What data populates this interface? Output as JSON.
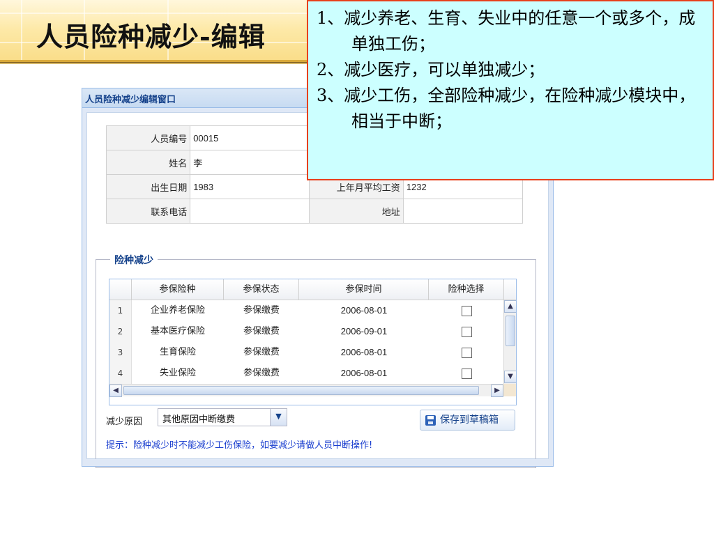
{
  "slide": {
    "title": "人员险种减少-编辑"
  },
  "callout": {
    "items": [
      "1、减少养老、生育、失业中的任意一个或多个，成单独工伤；",
      "2、减少医疗，可以单独减少；",
      "3、减少工伤，全部险种减少，在险种减少模块中，相当于中断；"
    ]
  },
  "window": {
    "title": "人员险种减少编辑窗口",
    "info": {
      "person_no_label": "人员编号",
      "person_no_value": "00015",
      "name_label": "姓名",
      "name_value": "李",
      "birth_label": "出生日期",
      "birth_value": "1983",
      "salary_label": "上年月平均工资",
      "salary_value": "1232",
      "phone_label": "联系电话",
      "phone_value": "",
      "address_label": "地址",
      "address_value": ""
    },
    "fieldset_title": "险种减少",
    "grid": {
      "columns": [
        "参保险种",
        "参保状态",
        "参保时间",
        "险种选择"
      ],
      "rows": [
        {
          "num": "1",
          "type": "企业养老保险",
          "status": "参保缴费",
          "date": "2006-08-01",
          "checked": false
        },
        {
          "num": "2",
          "type": "基本医疗保险",
          "status": "参保缴费",
          "date": "2006-09-01",
          "checked": false
        },
        {
          "num": "3",
          "type": "生育保险",
          "status": "参保缴费",
          "date": "2006-08-01",
          "checked": false
        },
        {
          "num": "4",
          "type": "失业保险",
          "status": "参保缴费",
          "date": "2006-08-01",
          "checked": false
        }
      ]
    },
    "reason_label": "减少原因",
    "reason_value": "其他原因中断缴费",
    "save_label": "保存到草稿箱",
    "hint": "提示：险种减少时不能减少工伤保险，如要减少请做人员中断操作!"
  },
  "colors": {
    "accent": "#15428b",
    "hint": "#1b3fcf",
    "callout_bg": "#ccffff",
    "callout_border": "#e8401c"
  }
}
